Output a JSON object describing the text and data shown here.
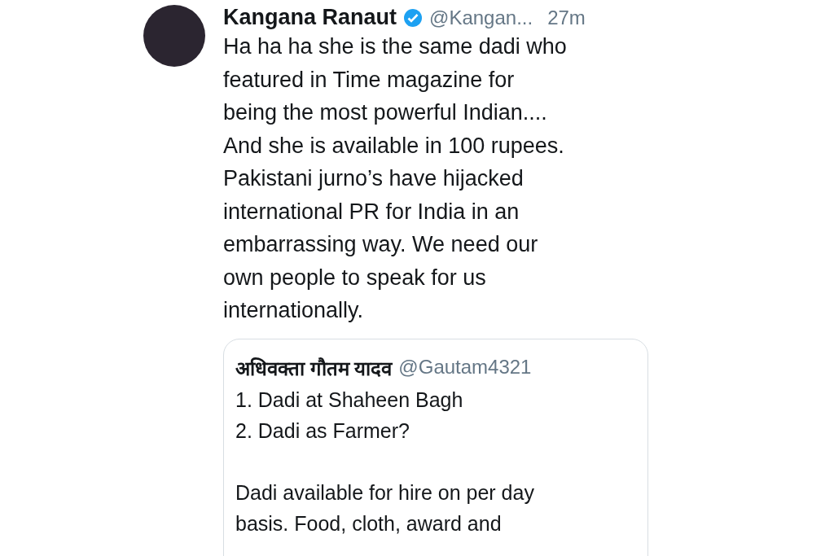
{
  "tweet": {
    "name": "Kangana Ranaut",
    "verified": true,
    "handle": "@Kangan...",
    "time": "27m",
    "lines": [
      "Ha ha ha she is the same dadi who",
      "featured in Time magazine for",
      "being the most powerful Indian....",
      "And she is available in 100 rupees.",
      "Pakistani jurno’s have hijacked",
      "international PR for India in an",
      "embarrassing way. We need our",
      "own people to speak for us",
      "internationally."
    ]
  },
  "quoted_tweet": {
    "name": "अधिवक्ता गौतम यादव",
    "handle": "@Gautam4321",
    "paragraphs": [
      [
        "1. Dadi at Shaheen Bagh",
        "2. Dadi as Farmer?"
      ],
      [
        "Dadi available for hire on per day",
        "basis. Food, cloth, award and"
      ]
    ]
  }
}
